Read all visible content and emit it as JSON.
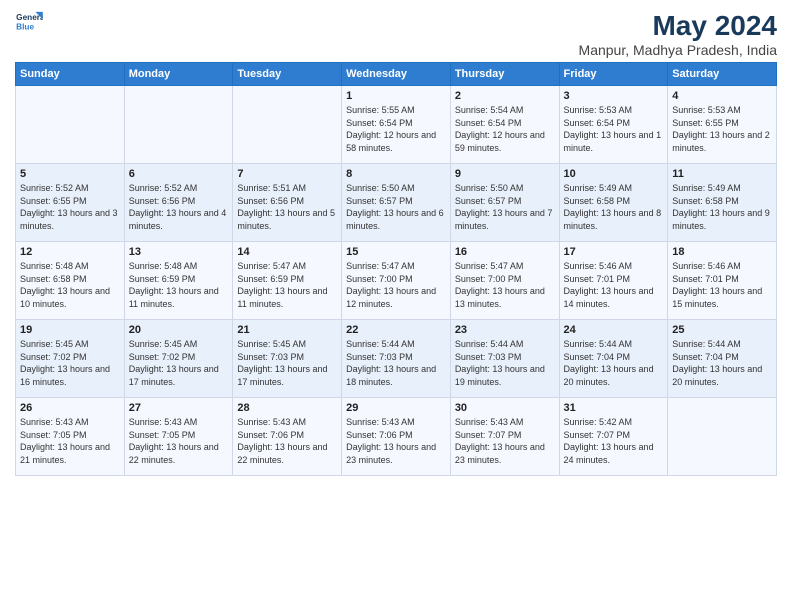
{
  "header": {
    "logo_line1": "General",
    "logo_line2": "Blue",
    "title": "May 2024",
    "subtitle": "Manpur, Madhya Pradesh, India"
  },
  "calendar": {
    "days_of_week": [
      "Sunday",
      "Monday",
      "Tuesday",
      "Wednesday",
      "Thursday",
      "Friday",
      "Saturday"
    ],
    "weeks": [
      [
        {
          "day": "",
          "info": ""
        },
        {
          "day": "",
          "info": ""
        },
        {
          "day": "",
          "info": ""
        },
        {
          "day": "1",
          "info": "Sunrise: 5:55 AM\nSunset: 6:54 PM\nDaylight: 12 hours\nand 58 minutes."
        },
        {
          "day": "2",
          "info": "Sunrise: 5:54 AM\nSunset: 6:54 PM\nDaylight: 12 hours\nand 59 minutes."
        },
        {
          "day": "3",
          "info": "Sunrise: 5:53 AM\nSunset: 6:54 PM\nDaylight: 13 hours\nand 1 minute."
        },
        {
          "day": "4",
          "info": "Sunrise: 5:53 AM\nSunset: 6:55 PM\nDaylight: 13 hours\nand 2 minutes."
        }
      ],
      [
        {
          "day": "5",
          "info": "Sunrise: 5:52 AM\nSunset: 6:55 PM\nDaylight: 13 hours\nand 3 minutes."
        },
        {
          "day": "6",
          "info": "Sunrise: 5:52 AM\nSunset: 6:56 PM\nDaylight: 13 hours\nand 4 minutes."
        },
        {
          "day": "7",
          "info": "Sunrise: 5:51 AM\nSunset: 6:56 PM\nDaylight: 13 hours\nand 5 minutes."
        },
        {
          "day": "8",
          "info": "Sunrise: 5:50 AM\nSunset: 6:57 PM\nDaylight: 13 hours\nand 6 minutes."
        },
        {
          "day": "9",
          "info": "Sunrise: 5:50 AM\nSunset: 6:57 PM\nDaylight: 13 hours\nand 7 minutes."
        },
        {
          "day": "10",
          "info": "Sunrise: 5:49 AM\nSunset: 6:58 PM\nDaylight: 13 hours\nand 8 minutes."
        },
        {
          "day": "11",
          "info": "Sunrise: 5:49 AM\nSunset: 6:58 PM\nDaylight: 13 hours\nand 9 minutes."
        }
      ],
      [
        {
          "day": "12",
          "info": "Sunrise: 5:48 AM\nSunset: 6:58 PM\nDaylight: 13 hours\nand 10 minutes."
        },
        {
          "day": "13",
          "info": "Sunrise: 5:48 AM\nSunset: 6:59 PM\nDaylight: 13 hours\nand 11 minutes."
        },
        {
          "day": "14",
          "info": "Sunrise: 5:47 AM\nSunset: 6:59 PM\nDaylight: 13 hours\nand 11 minutes."
        },
        {
          "day": "15",
          "info": "Sunrise: 5:47 AM\nSunset: 7:00 PM\nDaylight: 13 hours\nand 12 minutes."
        },
        {
          "day": "16",
          "info": "Sunrise: 5:47 AM\nSunset: 7:00 PM\nDaylight: 13 hours\nand 13 minutes."
        },
        {
          "day": "17",
          "info": "Sunrise: 5:46 AM\nSunset: 7:01 PM\nDaylight: 13 hours\nand 14 minutes."
        },
        {
          "day": "18",
          "info": "Sunrise: 5:46 AM\nSunset: 7:01 PM\nDaylight: 13 hours\nand 15 minutes."
        }
      ],
      [
        {
          "day": "19",
          "info": "Sunrise: 5:45 AM\nSunset: 7:02 PM\nDaylight: 13 hours\nand 16 minutes."
        },
        {
          "day": "20",
          "info": "Sunrise: 5:45 AM\nSunset: 7:02 PM\nDaylight: 13 hours\nand 17 minutes."
        },
        {
          "day": "21",
          "info": "Sunrise: 5:45 AM\nSunset: 7:03 PM\nDaylight: 13 hours\nand 17 minutes."
        },
        {
          "day": "22",
          "info": "Sunrise: 5:44 AM\nSunset: 7:03 PM\nDaylight: 13 hours\nand 18 minutes."
        },
        {
          "day": "23",
          "info": "Sunrise: 5:44 AM\nSunset: 7:03 PM\nDaylight: 13 hours\nand 19 minutes."
        },
        {
          "day": "24",
          "info": "Sunrise: 5:44 AM\nSunset: 7:04 PM\nDaylight: 13 hours\nand 20 minutes."
        },
        {
          "day": "25",
          "info": "Sunrise: 5:44 AM\nSunset: 7:04 PM\nDaylight: 13 hours\nand 20 minutes."
        }
      ],
      [
        {
          "day": "26",
          "info": "Sunrise: 5:43 AM\nSunset: 7:05 PM\nDaylight: 13 hours\nand 21 minutes."
        },
        {
          "day": "27",
          "info": "Sunrise: 5:43 AM\nSunset: 7:05 PM\nDaylight: 13 hours\nand 22 minutes."
        },
        {
          "day": "28",
          "info": "Sunrise: 5:43 AM\nSunset: 7:06 PM\nDaylight: 13 hours\nand 22 minutes."
        },
        {
          "day": "29",
          "info": "Sunrise: 5:43 AM\nSunset: 7:06 PM\nDaylight: 13 hours\nand 23 minutes."
        },
        {
          "day": "30",
          "info": "Sunrise: 5:43 AM\nSunset: 7:07 PM\nDaylight: 13 hours\nand 23 minutes."
        },
        {
          "day": "31",
          "info": "Sunrise: 5:42 AM\nSunset: 7:07 PM\nDaylight: 13 hours\nand 24 minutes."
        },
        {
          "day": "",
          "info": ""
        }
      ]
    ]
  }
}
